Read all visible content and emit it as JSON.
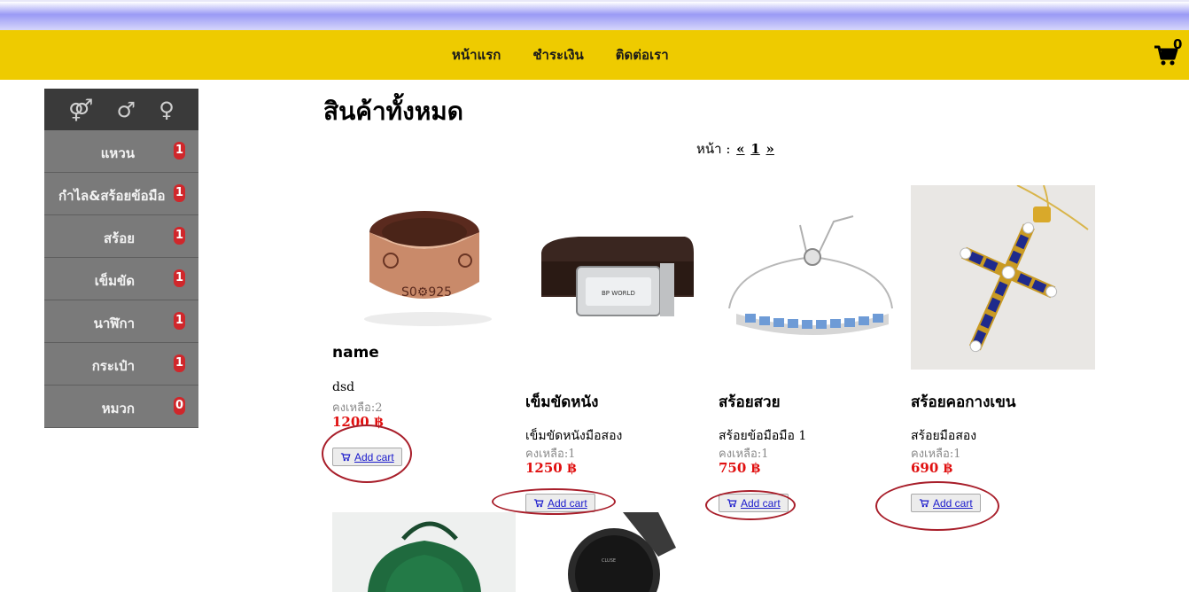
{
  "nav": {
    "links": [
      "หน้าแรก",
      "ชำระเงิน",
      "ติดต่อเรา"
    ],
    "cart_count": "0",
    "cart_icon": "cart-icon",
    "colors": {
      "bar": "#eecb00"
    }
  },
  "sidebar": {
    "genders": [
      "⚤",
      "♂",
      "♀"
    ],
    "categories": [
      {
        "label": "แหวน",
        "count": "1"
      },
      {
        "label": "กำไล&สร้อยข้อมือ",
        "count": "1"
      },
      {
        "label": "สร้อย",
        "count": "1"
      },
      {
        "label": "เข็มขัด",
        "count": "1"
      },
      {
        "label": "นาฬิกา",
        "count": "1"
      },
      {
        "label": "กระเป๋า",
        "count": "1"
      },
      {
        "label": "หมวก",
        "count": "0"
      }
    ]
  },
  "main": {
    "title": "สินค้าทั้งหมด",
    "pager": {
      "label": "หน้า :",
      "prev": "«",
      "current": "1",
      "next": "»"
    }
  },
  "products": [
    {
      "name": "name",
      "desc": "dsd",
      "stock": "คงเหลือ:2",
      "price": "1200 ฿",
      "button": "Add cart"
    },
    {
      "name": "เข็มขัดหนัง",
      "desc": "เข็มขัดหนังมือสอง",
      "stock": "คงเหลือ:1",
      "price": "1250 ฿",
      "button": "Add cart"
    },
    {
      "name": "สร้อยสวย",
      "desc": "สร้อยข้อมือมือ 1",
      "stock": "คงเหลือ:1",
      "price": "750 ฿",
      "button": "Add cart"
    },
    {
      "name": "สร้อยคอกางเขน",
      "desc": "สร้อยมือสอง",
      "stock": "คงเหลือ:1",
      "price": "690 ฿",
      "button": "Add cart"
    }
  ]
}
